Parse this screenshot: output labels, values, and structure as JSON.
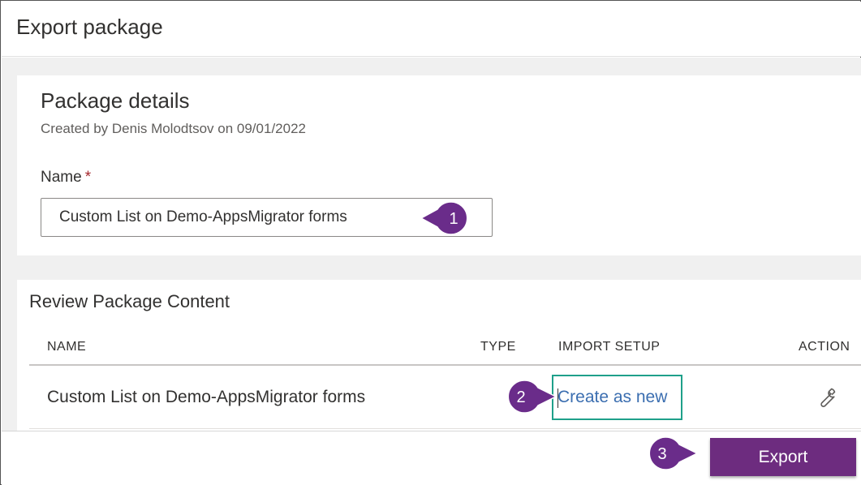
{
  "dialog": {
    "title": "Export package"
  },
  "package_details": {
    "title": "Package details",
    "subtitle": "Created by Denis Molodtsov on 09/01/2022",
    "name_label": "Name",
    "required_marker": "*",
    "name_value": "Custom List on Demo-AppsMigrator forms"
  },
  "review": {
    "title": "Review Package Content",
    "columns": [
      "NAME",
      "TYPE",
      "IMPORT SETUP",
      "ACTION"
    ],
    "rows": [
      {
        "name": "Custom List on Demo-AppsMigrator forms",
        "type": "",
        "import_setup": "Create as new",
        "action_icon": "wrench-icon"
      }
    ]
  },
  "footer": {
    "export_label": "Export"
  },
  "callouts": [
    "1",
    "2",
    "3"
  ],
  "colors": {
    "accent_purple": "#6d2c7f",
    "callout_purple": "#6a2c8a",
    "highlight_teal": "#1fa08a",
    "link_blue": "#3b6eb0"
  }
}
